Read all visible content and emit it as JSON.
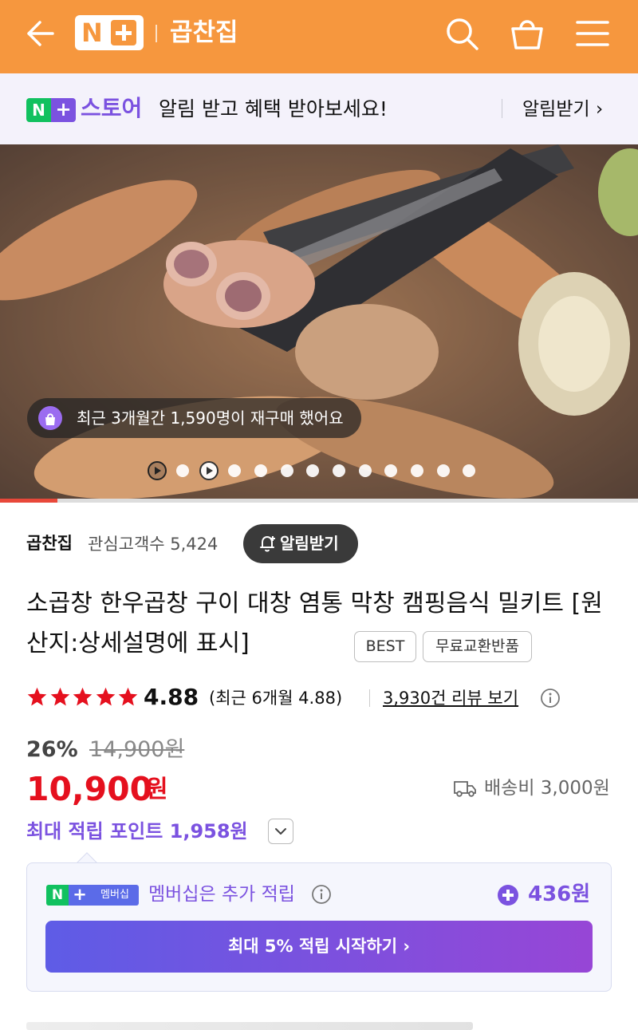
{
  "header": {
    "logo_text": "N+",
    "store_name": "곱찬집"
  },
  "notice": {
    "store_label": "스토어",
    "message": "알림 받고 혜택 받아보세요!",
    "link": "알림받기 ›"
  },
  "gallery": {
    "repurchase_text": "최근 3개월간 1,590명이 재구매 했어요",
    "slide_count": 13,
    "video_indicators": 2,
    "progress_fraction": 0.09
  },
  "seller": {
    "name": "곱찬집",
    "followers_label": "관심고객수 5,424",
    "alarm_button": "알림받기"
  },
  "product": {
    "title": "소곱창 한우곱창 구이 대창 염통 막창 캠핑음식 밀키트 [원산지:상세설명에 표시]",
    "tags": [
      "BEST",
      "무료교환반품"
    ]
  },
  "rating": {
    "stars": 5,
    "score": "4.88",
    "recent": "(최근 6개월 4.88)",
    "reviews_link": "3,930건 리뷰 보기"
  },
  "price": {
    "discount": "26%",
    "original": "14,900원",
    "current": "10,900",
    "currency": "원",
    "shipping": "배송비 3,000원",
    "points": "최대 적립 포인트 1,958원"
  },
  "membership": {
    "badge_n": "N",
    "badge_text": "멤버십",
    "text": "멤버십은 추가 적립",
    "amount": "436원",
    "button": "최대 5% 적립 시작하기 ›"
  },
  "colors": {
    "header": "#f6973e",
    "accent_purple": "#7b52e0",
    "price_red": "#e5101e",
    "naver_green": "#11c15f"
  }
}
